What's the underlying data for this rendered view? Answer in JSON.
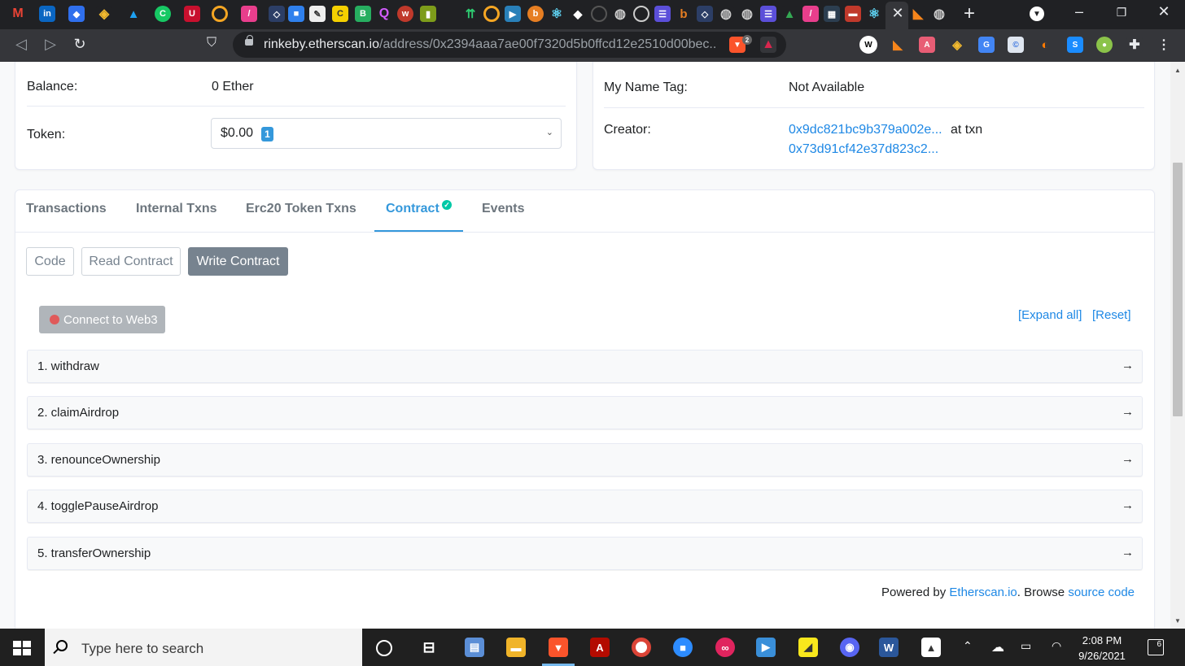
{
  "browser": {
    "url_host": "rinkeby.etherscan.io",
    "url_path": "/address/0x2394aaa7ae00f7320d5b0ffcd12e2510d00bec...",
    "ext_badge_count": "2"
  },
  "overview": {
    "balance_label": "Balance:",
    "balance_value": "0 Ether",
    "token_label": "Token:",
    "token_value": "$0.00",
    "token_count": "1"
  },
  "more_info": {
    "name_tag_label": "My Name Tag:",
    "name_tag_value": "Not Available",
    "creator_label": "Creator:",
    "creator_address": "0x9dc821bc9b379a002e...",
    "at_txn": "at txn",
    "creator_txn": "0x73d91cf42e37d823c2..."
  },
  "tabs": [
    {
      "label": "Transactions"
    },
    {
      "label": "Internal Txns"
    },
    {
      "label": "Erc20 Token Txns"
    },
    {
      "label": "Contract"
    },
    {
      "label": "Events"
    }
  ],
  "contract_tabs": {
    "code": "Code",
    "read": "Read Contract",
    "write": "Write Contract"
  },
  "write": {
    "connect_label": "Connect to Web3",
    "expand_all": "[Expand all]",
    "reset": "[Reset]",
    "functions": [
      {
        "label": "1. withdraw"
      },
      {
        "label": "2. claimAirdrop"
      },
      {
        "label": "3. renounceOwnership"
      },
      {
        "label": "4. togglePauseAirdrop"
      },
      {
        "label": "5. transferOwnership"
      }
    ]
  },
  "footer": {
    "powered_by": "Powered by",
    "etherscan_link": "Etherscan.io",
    "browse": ". Browse",
    "source_code": "source code"
  },
  "taskbar": {
    "search_placeholder": "Type here to search",
    "time": "2:08 PM",
    "date": "9/26/2021",
    "notification_count": "6"
  },
  "colors": {
    "accent": "#3498db",
    "link": "#1e88e5",
    "verified": "#00c9a7"
  }
}
